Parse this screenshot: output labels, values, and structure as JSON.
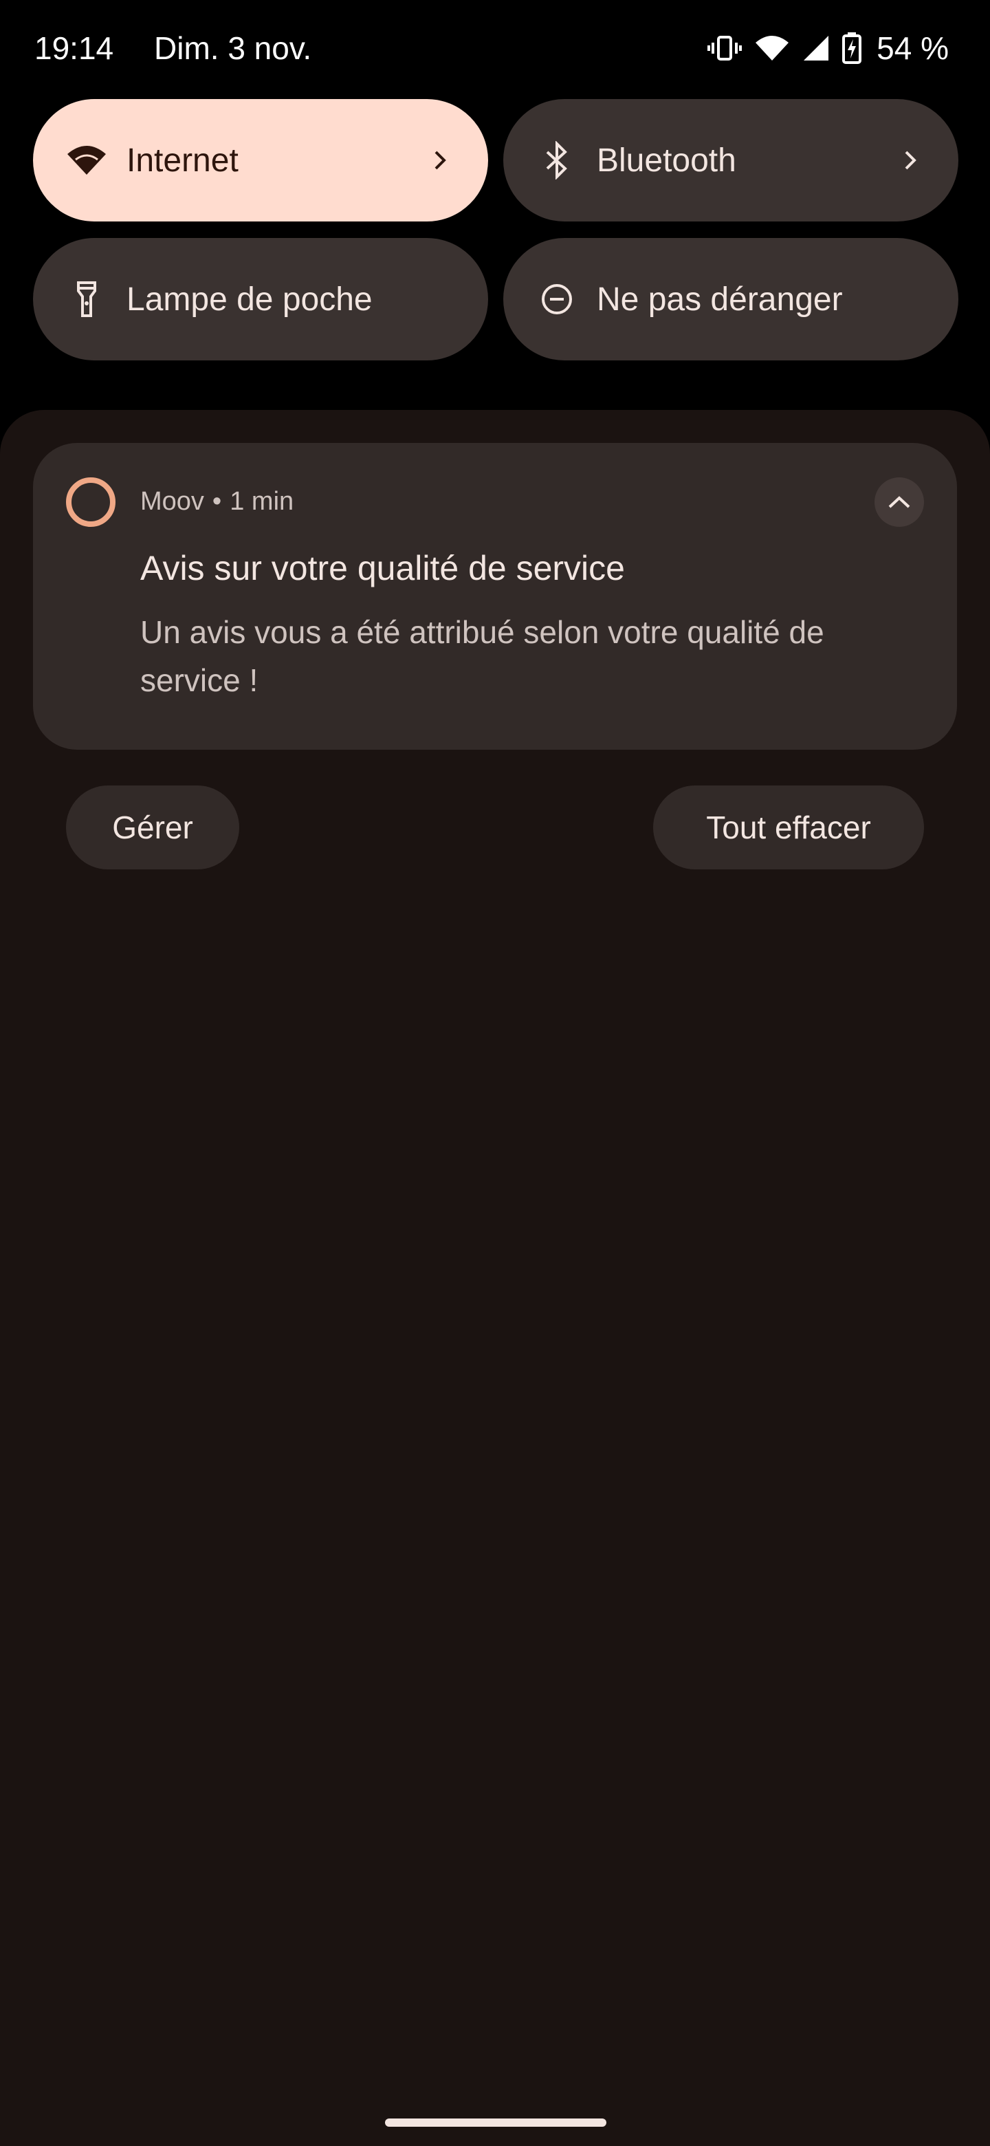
{
  "status_bar": {
    "time": "19:14",
    "date": "Dim. 3 nov.",
    "battery_percent": "54 %",
    "icons": [
      "vibrate-icon",
      "wifi-icon",
      "cellular-signal-icon",
      "battery-charging-icon"
    ]
  },
  "quick_settings": {
    "tiles": [
      {
        "label": "Internet",
        "icon": "wifi-icon",
        "active": true,
        "has_chevron": true
      },
      {
        "label": "Bluetooth",
        "icon": "bluetooth-icon",
        "active": false,
        "has_chevron": true
      },
      {
        "label": "Lampe de poche",
        "icon": "flashlight-icon",
        "active": false,
        "has_chevron": false
      },
      {
        "label": "Ne pas déranger",
        "icon": "do-not-disturb-icon",
        "active": false,
        "has_chevron": false
      }
    ]
  },
  "notification": {
    "app_name": "Moov",
    "separator": "•",
    "time": "1 min",
    "title": "Avis sur votre qualité de service",
    "body": "Un avis vous a été attribué selon votre qualité de service !"
  },
  "actions": {
    "manage_label": "Gérer",
    "clear_all_label": "Tout effacer"
  },
  "colors": {
    "active_tile": "#ffdccf",
    "inactive_tile": "#3a3230",
    "shade_background": "#1b1311",
    "card_background": "#322a28",
    "app_icon_accent": "#f0a886"
  }
}
